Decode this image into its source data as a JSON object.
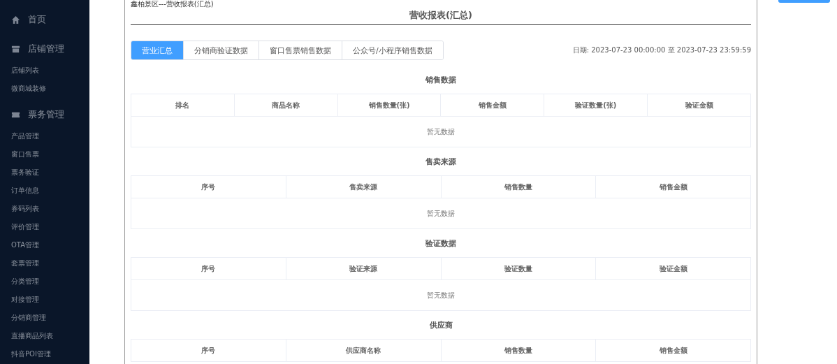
{
  "sidebar": {
    "items": [
      {
        "label": "首页",
        "kind": "group"
      },
      {
        "label": "店铺管理",
        "kind": "group"
      },
      {
        "label": "店铺列表",
        "kind": "item"
      },
      {
        "label": "微商城装修",
        "kind": "item"
      },
      {
        "label": "票务管理",
        "kind": "group"
      },
      {
        "label": "产品管理",
        "kind": "item"
      },
      {
        "label": "窗口售票",
        "kind": "item"
      },
      {
        "label": "票务验证",
        "kind": "item"
      },
      {
        "label": "订单信息",
        "kind": "item"
      },
      {
        "label": "券码列表",
        "kind": "item"
      },
      {
        "label": "评价管理",
        "kind": "item"
      },
      {
        "label": "OTA管理",
        "kind": "item"
      },
      {
        "label": "套票管理",
        "kind": "item"
      },
      {
        "label": "分类管理",
        "kind": "item"
      },
      {
        "label": "对接管理",
        "kind": "item"
      },
      {
        "label": "分销商管理",
        "kind": "item"
      },
      {
        "label": "直播商品列表",
        "kind": "item"
      },
      {
        "label": "抖音POI管理",
        "kind": "item"
      }
    ]
  },
  "report": {
    "caption": "鑫柏景区---营收报表(汇总)",
    "title": "营收报表(汇总)",
    "tabs": [
      {
        "label": "营业汇总",
        "selected": true
      },
      {
        "label": "分销商验证数据",
        "selected": false
      },
      {
        "label": "窗口售票销售数据",
        "selected": false
      },
      {
        "label": "公众号/小程序销售数据",
        "selected": false
      }
    ],
    "date": "日期: 2023-07-23 00:00:00 至 2023-07-23 23:59:59",
    "sections": [
      {
        "title": "销售数据",
        "columns": [
          "排名",
          "商品名称",
          "销售数量(张)",
          "销售金额",
          "验证数量(张)",
          "验证金额"
        ],
        "empty": "暂无数据"
      },
      {
        "title": "售卖来源",
        "columns": [
          "序号",
          "售卖来源",
          "销售数量",
          "销售金额"
        ],
        "empty": "暂无数据"
      },
      {
        "title": "验证数据",
        "columns": [
          "序号",
          "验证来源",
          "验证数量",
          "验证金额"
        ],
        "empty": "暂无数据"
      },
      {
        "title": "供应商",
        "columns": [
          "序号",
          "供应商名称",
          "销售数量",
          "销售金额"
        ]
      }
    ]
  }
}
